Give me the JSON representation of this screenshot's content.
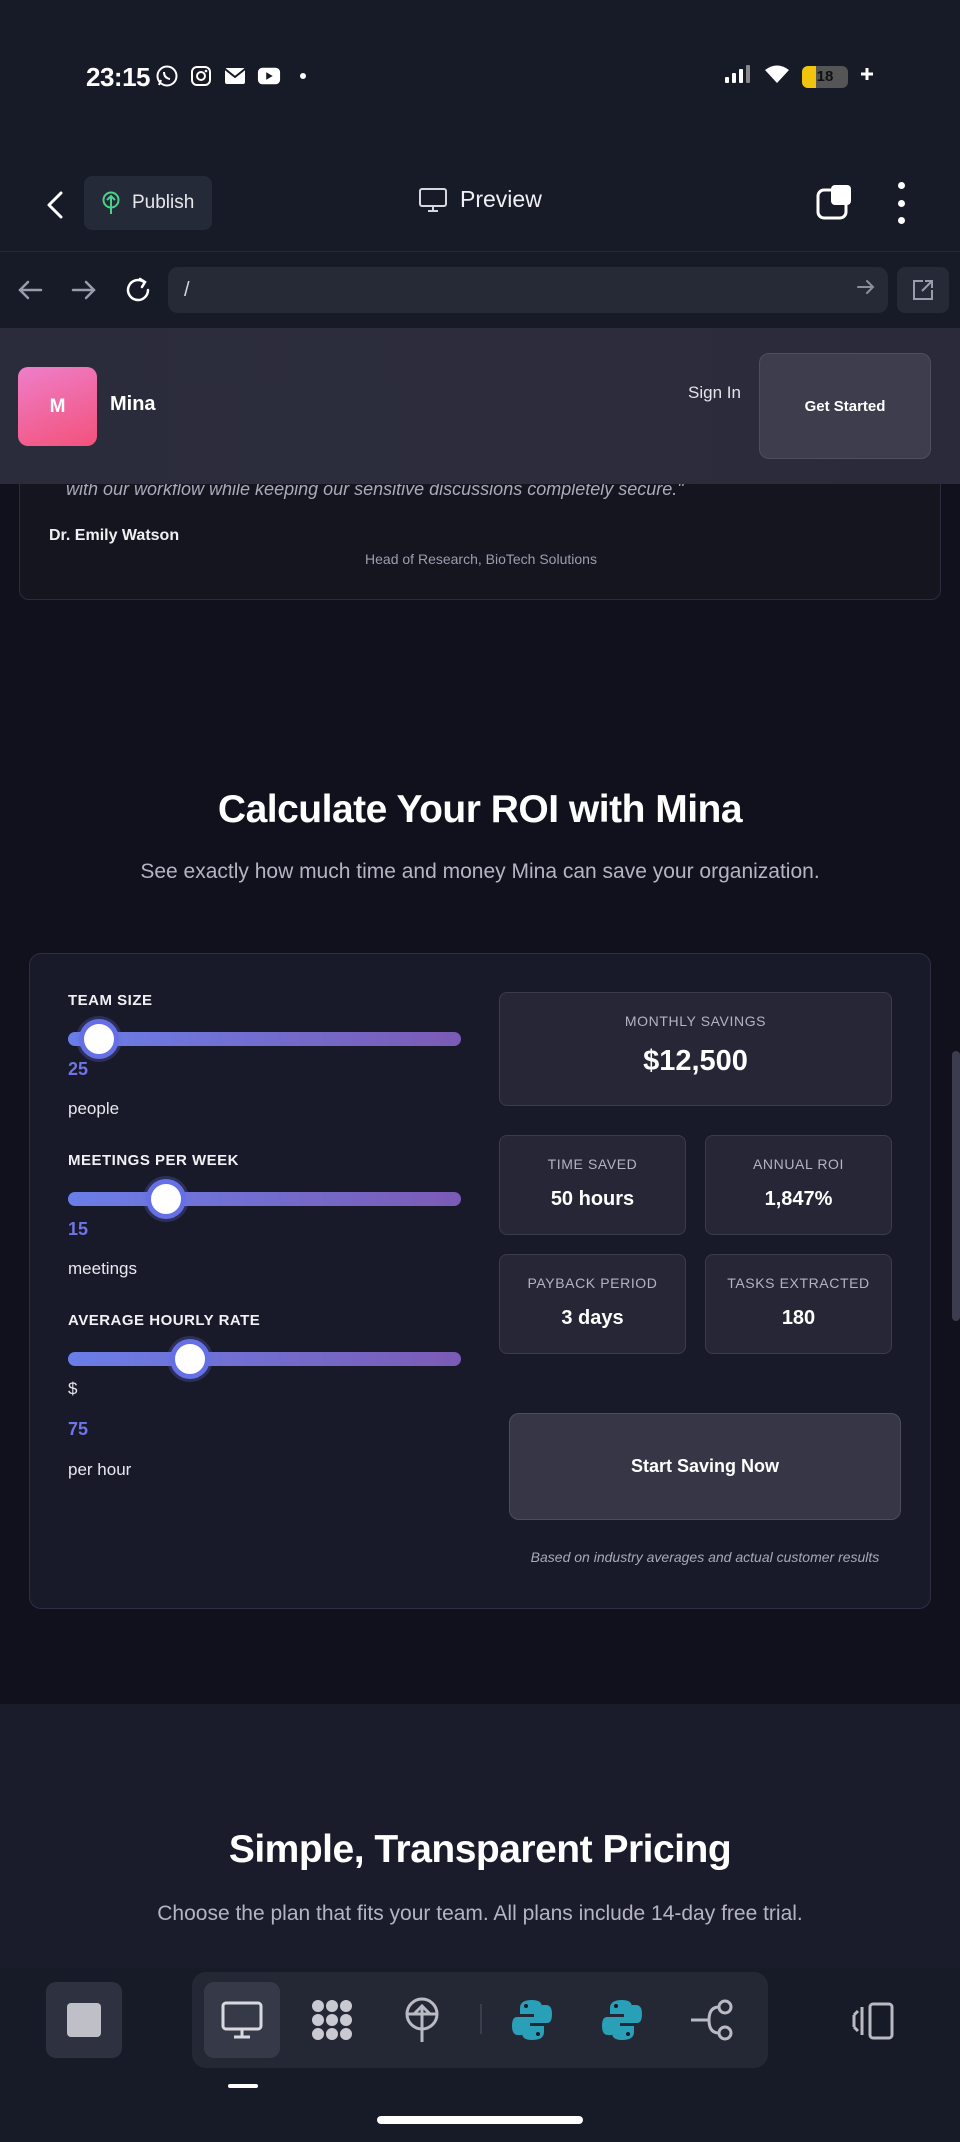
{
  "status_bar": {
    "time": "23:15",
    "battery": "18"
  },
  "toolbar": {
    "publish_label": "Publish",
    "preview_label": "Preview"
  },
  "browser": {
    "url": "/"
  },
  "site_header": {
    "logo_letter": "M",
    "brand": "Mina",
    "sign_in": "Sign In",
    "get_started": "Get Started"
  },
  "testimonial": {
    "quote": "with our workflow while keeping our sensitive discussions completely secure.\"",
    "name": "Dr. Emily Watson",
    "role": "Head of Research, BioTech Solutions"
  },
  "roi": {
    "title": "Calculate Your ROI with Mina",
    "subtitle": "See exactly how much time and money Mina can save your organization.",
    "controls": [
      {
        "label": "TEAM SIZE",
        "value": "25",
        "unit": "people",
        "level": 0.08
      },
      {
        "label": "MEETINGS PER WEEK",
        "value": "15",
        "unit": "meetings",
        "level": 0.25
      },
      {
        "label": "AVERAGE HOURLY RATE",
        "prefix": "$",
        "value": "75",
        "unit": "per hour",
        "level": 0.31
      }
    ],
    "monthly_savings": {
      "label": "MONTHLY SAVINGS",
      "value": "$12,500"
    },
    "time_saved": {
      "label": "TIME SAVED",
      "value": "50 hours"
    },
    "annual_roi": {
      "label": "ANNUAL ROI",
      "value": "1,847%"
    },
    "payback_period": {
      "label": "PAYBACK PERIOD",
      "value": "3 days"
    },
    "tasks_extracted": {
      "label": "TASKS EXTRACTED",
      "value": "180"
    },
    "cta": "Start Saving Now",
    "disclaimer": "Based on industry averages and actual customer results"
  },
  "pricing": {
    "title": "Simple, Transparent Pricing",
    "subtitle": "Choose the plan that fits your team. All plans include 14-day free trial."
  },
  "colors": {
    "accent": "#6f74e6",
    "background": "#11111e",
    "card": "#191a29"
  },
  "icons": [
    "whatsapp-icon",
    "instagram-icon",
    "mail-icon",
    "youtube-icon",
    "signal-icon",
    "wifi-icon",
    "back-icon",
    "publish-icon",
    "monitor-icon",
    "tabs-icon",
    "more-icon",
    "arrow-left-icon",
    "arrow-right-icon",
    "reload-icon",
    "external-link-icon",
    "stop-icon",
    "desktop-icon",
    "grid-dots-icon",
    "antenna-icon",
    "python-icon",
    "share-node-icon",
    "panel-icon"
  ]
}
